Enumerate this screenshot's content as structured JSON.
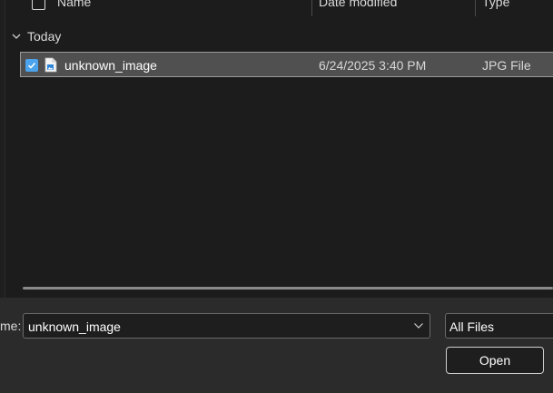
{
  "columns": {
    "name": "Name",
    "date_modified": "Date modified",
    "type": "Type"
  },
  "group": {
    "label": "Today"
  },
  "files": [
    {
      "name": "unknown_image",
      "date": "6/24/2025 3:40 PM",
      "type": "JPG File",
      "selected": true
    }
  ],
  "footer": {
    "filename_label": "me:",
    "filename_value": "unknown_image",
    "filetype_value": "All Files",
    "open_label": "Open"
  },
  "colors": {
    "accent": "#4aa3ec",
    "row_selected": "#505050",
    "background": "#1c1c1c"
  },
  "icons": {
    "group_chevron": "chevron-down-icon",
    "file": "image-file-icon",
    "check": "checkmark-icon"
  }
}
